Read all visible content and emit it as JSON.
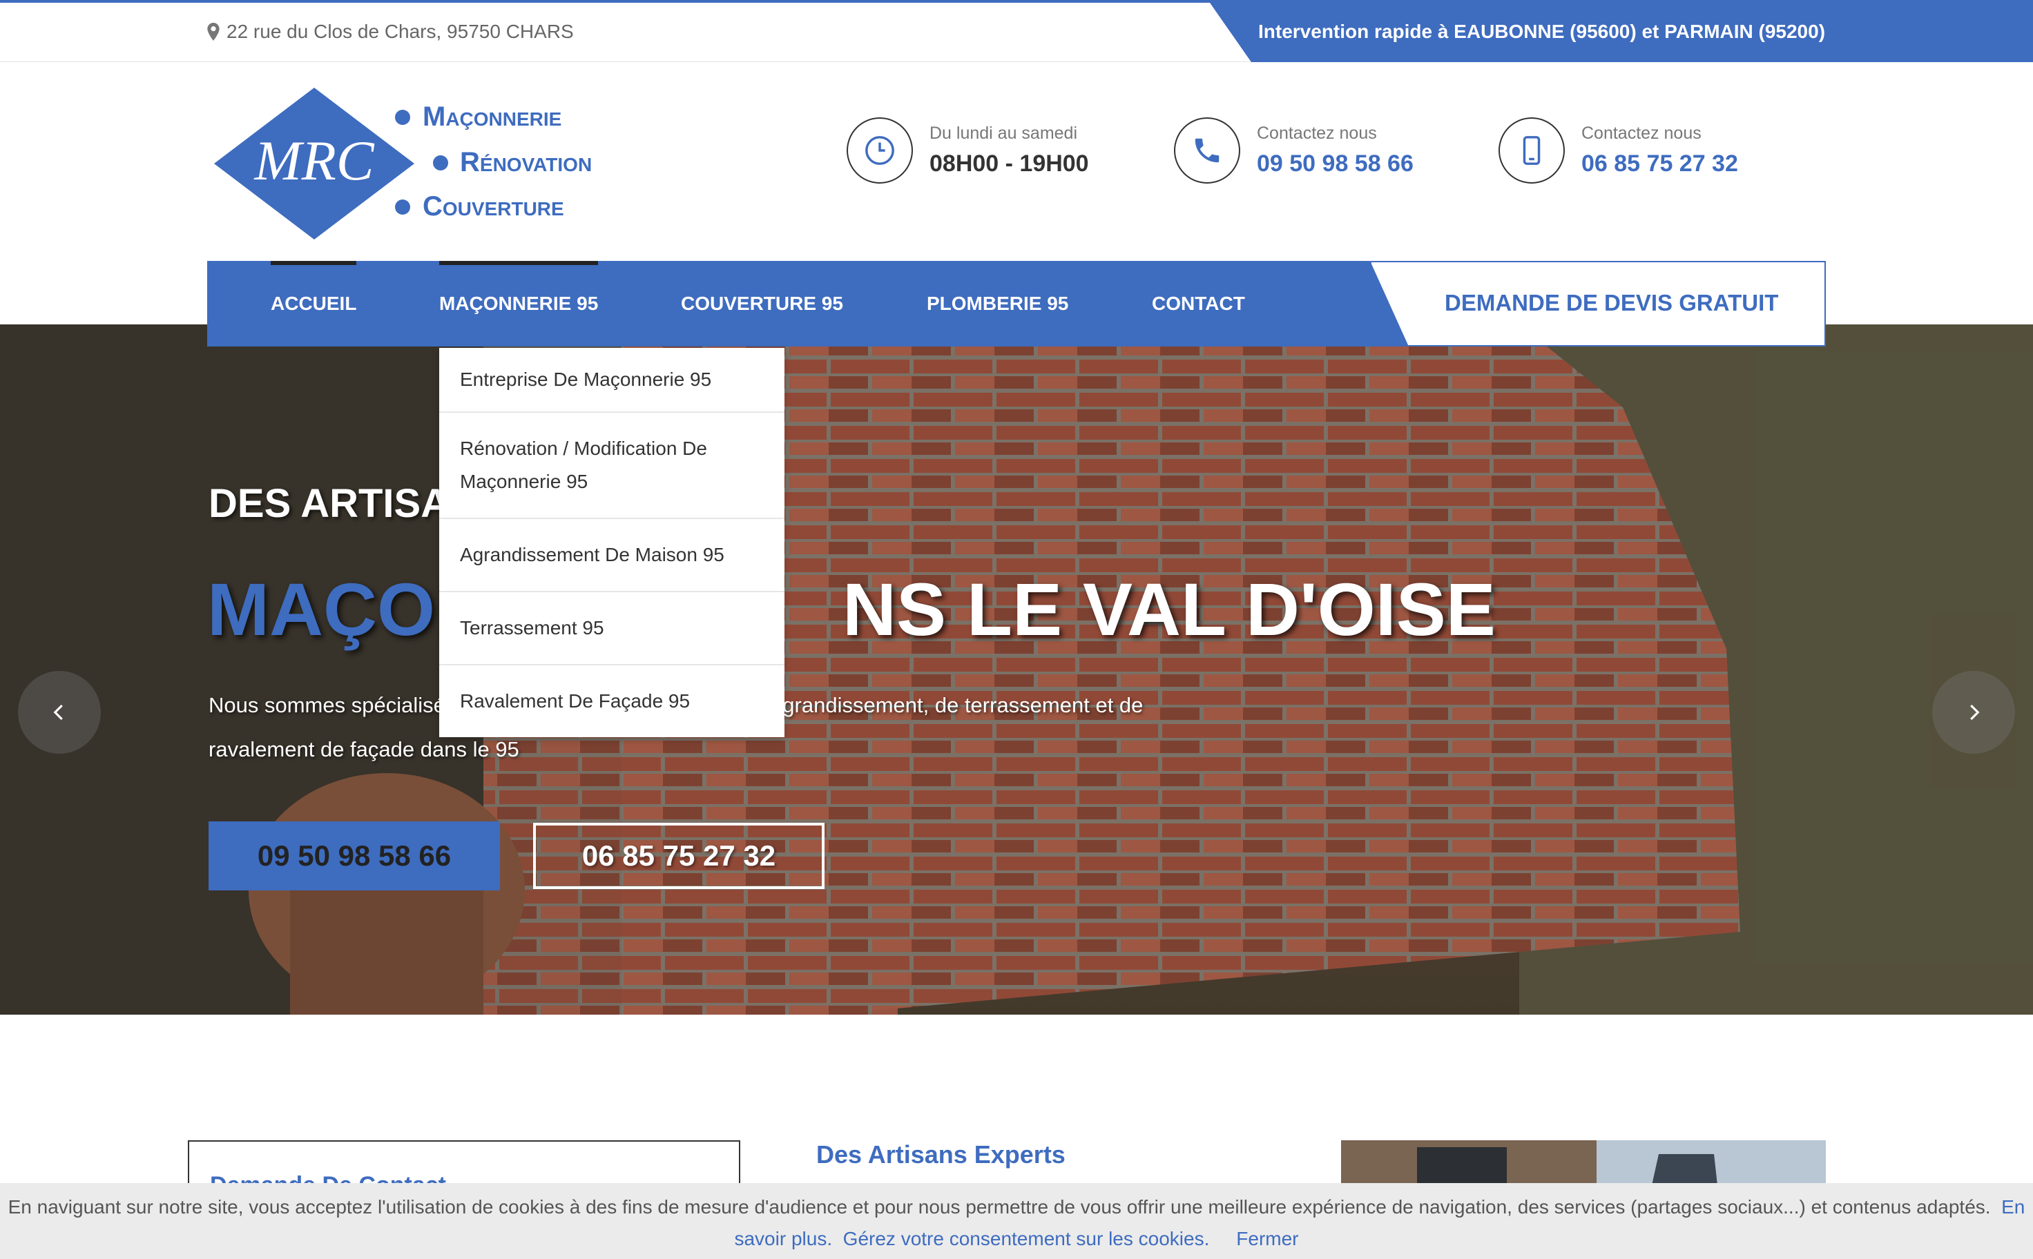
{
  "topbar": {
    "address": "22 rue du Clos de Chars, 95750 CHARS",
    "intervention": "Intervention rapide à EAUBONNE (95600) et PARMAIN (95200)"
  },
  "logo": {
    "initials": "MRC",
    "line1": "Maçonnerie",
    "line2": "Rénovation",
    "line3": "Couverture"
  },
  "header_info": [
    {
      "label": "Du lundi au samedi",
      "value": "08H00 - 19H00",
      "icon": "clock-icon"
    },
    {
      "label": "Contactez nous",
      "value": "09 50 98 58 66",
      "icon": "phone-icon"
    },
    {
      "label": "Contactez nous",
      "value": "06 85 75 27 32",
      "icon": "mobile-icon"
    }
  ],
  "nav": {
    "items": [
      "ACCUEIL",
      "MAÇONNERIE 95",
      "COUVERTURE 95",
      "PLOMBERIE 95",
      "CONTACT"
    ],
    "devis": "DEMANDE DE DEVIS GRATUIT"
  },
  "dropdown": {
    "items": [
      "Entreprise De Maçonnerie 95",
      "Rénovation / Modification De Maçonnerie 95",
      "Agrandissement De Maison 95",
      "Terrassement 95",
      "Ravalement De Façade 95"
    ]
  },
  "hero": {
    "subtitle_visible": "DES ARTISA",
    "title_blue": "MAÇON",
    "title_white": "NS LE VAL D'OISE",
    "description": "Nous sommes spécialisé dans les travaux de rénovation, d'agrandissement, de terrassement et de ravalement de façade dans le 95",
    "button1": "09 50 98 58 66",
    "button2": "06 85 75 27 32"
  },
  "content": {
    "contact_title": "Demande De Contact",
    "experts_title": "Des Artisans Experts"
  },
  "cookie": {
    "text": "En naviguant sur notre site, vous acceptez l'utilisation de cookies à des fins de mesure d'audience et pour nous permettre de vous offrir une meilleure expérience de navigation, des services (partages sociaux...) et contenus adaptés.",
    "more_link": "En savoir plus.",
    "consent_link": "Gérez votre consentement sur les cookies.",
    "close": "Fermer"
  },
  "colors": {
    "brand": "#3e6cbf",
    "dark": "#222222"
  }
}
